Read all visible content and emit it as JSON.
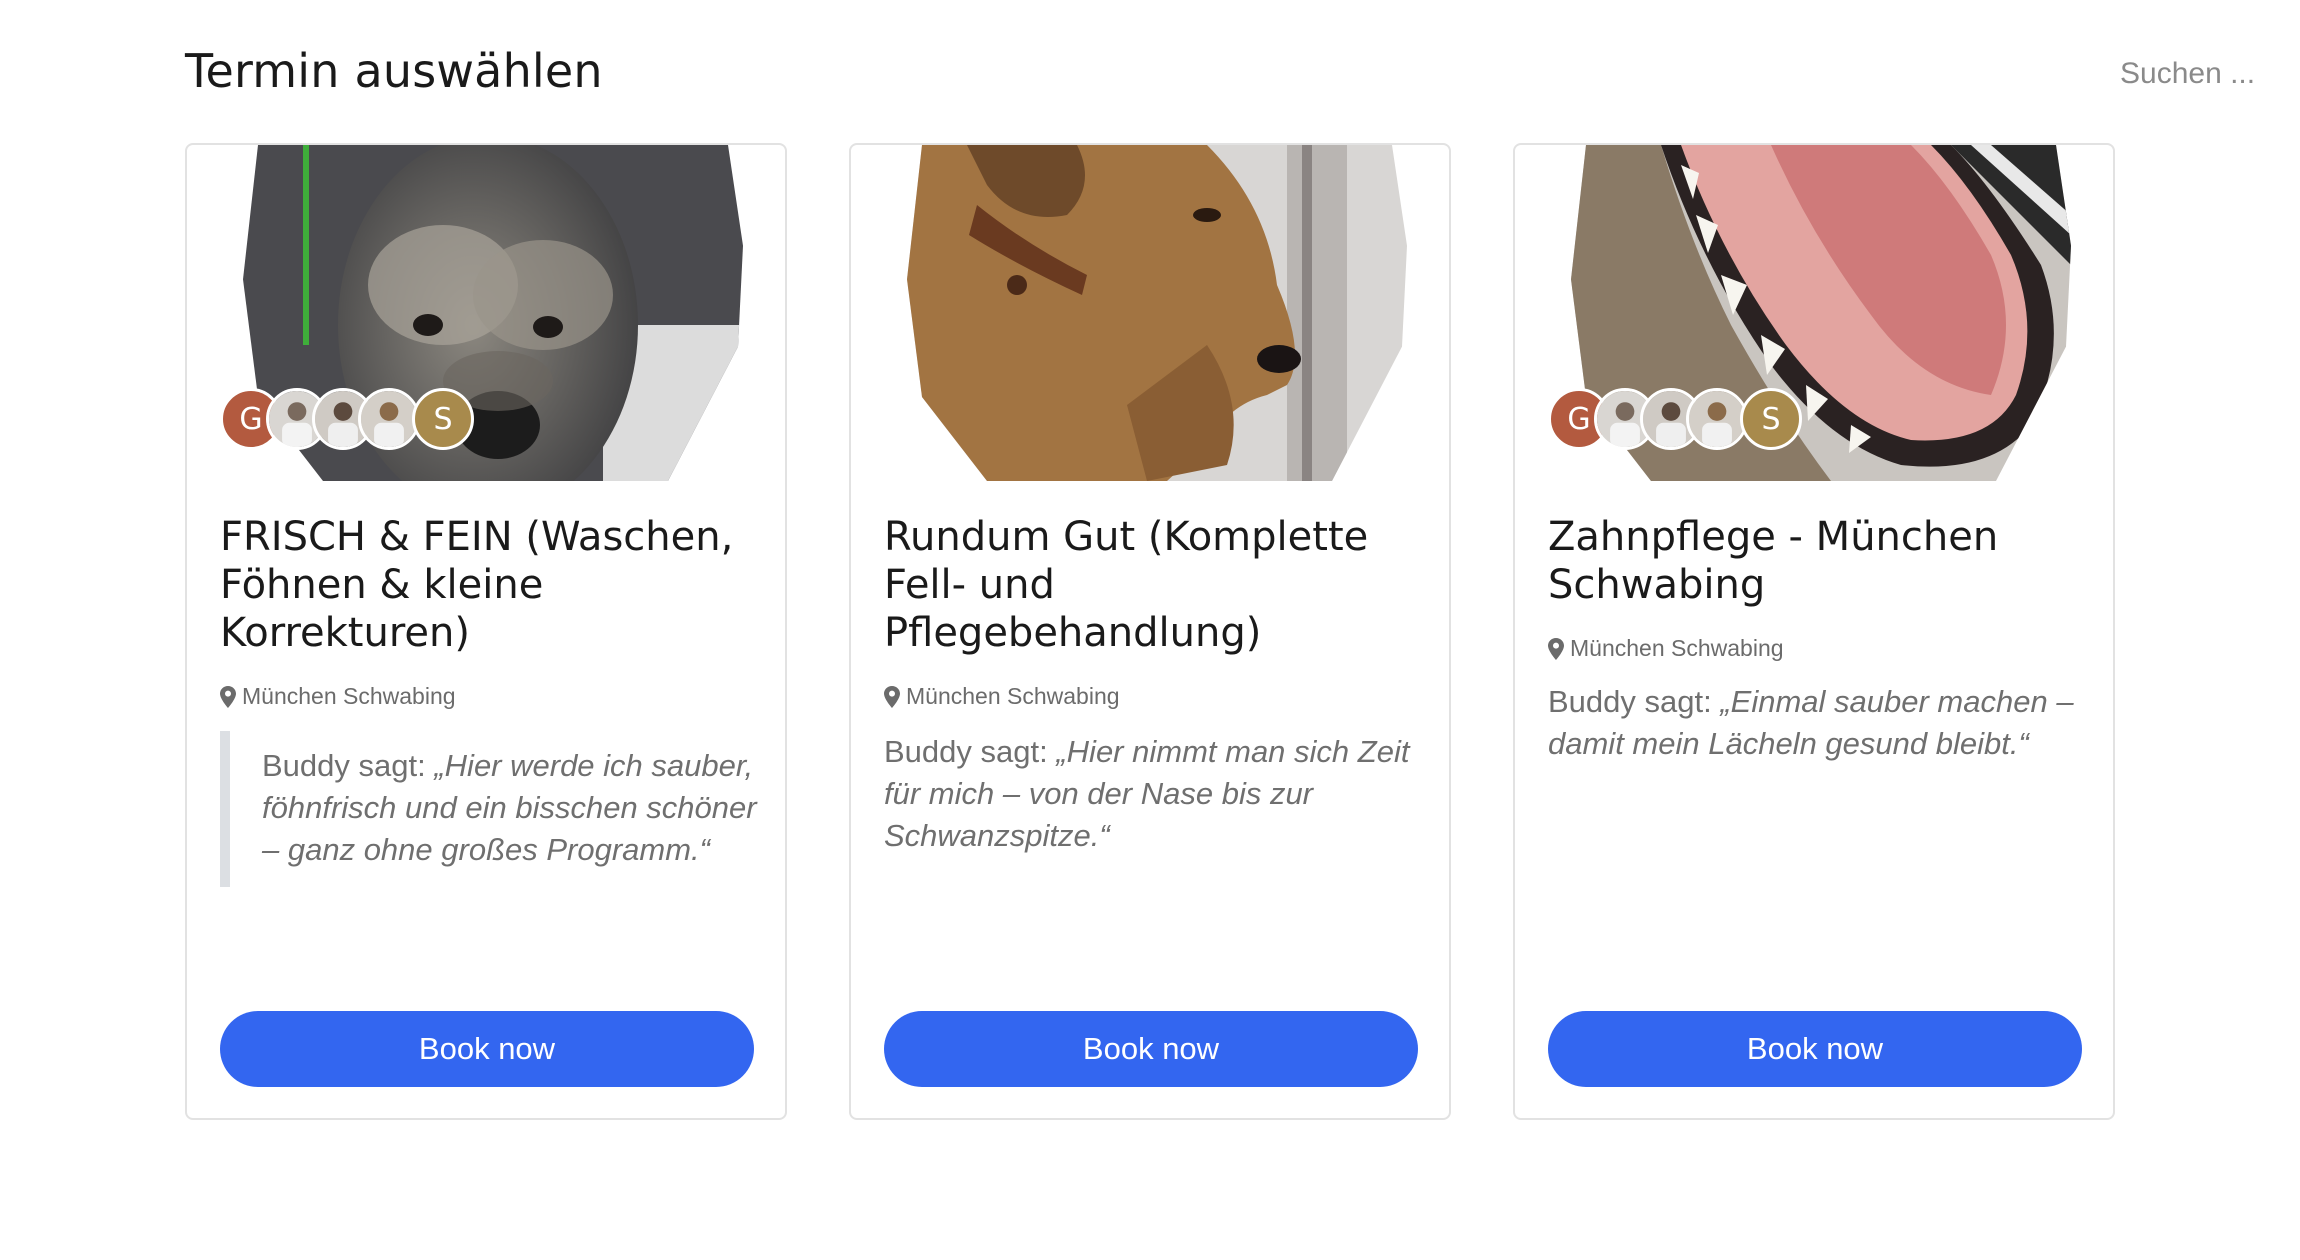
{
  "header": {
    "title": "Termin auswählen",
    "search_placeholder": "Suchen ..."
  },
  "cards": [
    {
      "title": "FRISCH & FEIN (Waschen, Föhnen & kleine Korrekturen)",
      "location": "München Schwabing",
      "quote_lead": "Buddy sagt: ",
      "quote_text": "„Hier werde ich sauber, föhnfrisch und ein bisschen schöner – ganz ohne großes Programm.“",
      "button_label": "Book now",
      "avatars": [
        {
          "letter": "G",
          "color": "#b35a3f"
        },
        {
          "letter": "",
          "color": "#c8c4bf"
        },
        {
          "letter": "",
          "color": "#bdb6ad"
        },
        {
          "letter": "",
          "color": "#c7c1ba"
        },
        {
          "letter": "S",
          "color": "#a88a4c"
        }
      ]
    },
    {
      "title": "Rundum Gut (Komplette Fell- und Pflegebehandlung)",
      "location": "München Schwabing",
      "quote_lead": "Buddy sagt: ",
      "quote_text": "„Hier nimmt man sich Zeit für mich – von der Nase bis zur Schwanzspitze.“",
      "button_label": "Book now",
      "avatars": []
    },
    {
      "title": "Zahnpflege - München Schwabing",
      "location": "München Schwabing",
      "quote_lead": "Buddy sagt: ",
      "quote_text": "„Einmal sauber machen – damit mein Lächeln gesund bleibt.“",
      "button_label": "Book now",
      "avatars": [
        {
          "letter": "G",
          "color": "#b35a3f"
        },
        {
          "letter": "",
          "color": "#c8c4bf"
        },
        {
          "letter": "",
          "color": "#bdb6ad"
        },
        {
          "letter": "",
          "color": "#c7c1ba"
        },
        {
          "letter": "S",
          "color": "#a88a4c"
        }
      ]
    }
  ],
  "colors": {
    "accent": "#3366f0",
    "card_border": "#e2e2e2",
    "quote_bar": "#dcdfe3"
  },
  "icons": {
    "location": "map-pin-icon"
  }
}
